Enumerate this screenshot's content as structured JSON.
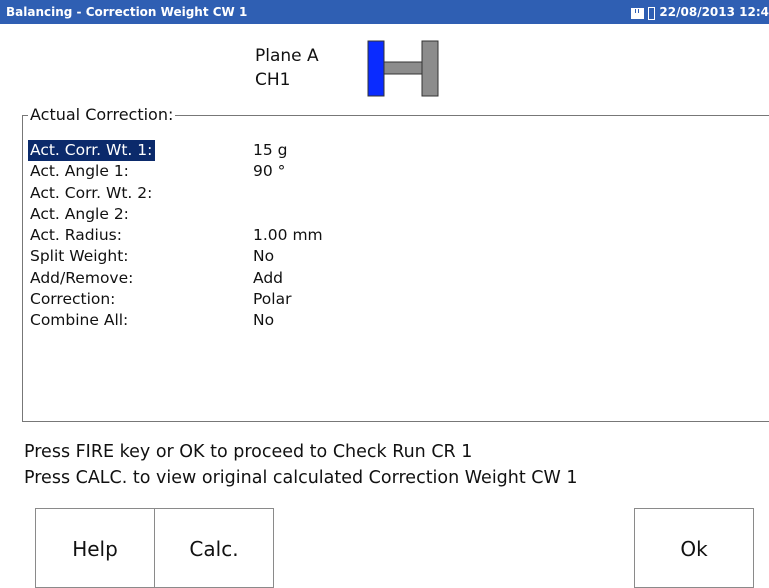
{
  "title_bar": {
    "title": "Balancing - Correction Weight CW 1",
    "datetime": "22/08/2013 12:4",
    "icons": [
      "memory-card-icon",
      "battery-icon"
    ]
  },
  "plane": {
    "name": "Plane A",
    "channel": "CH1"
  },
  "group": {
    "legend": "Actual Correction:",
    "fields": [
      {
        "label": "Act. Corr. Wt. 1:",
        "value": "15 g",
        "selected": true
      },
      {
        "label": "Act. Angle 1:",
        "value": "90 °"
      },
      {
        "label": "Act. Corr. Wt. 2:",
        "value": ""
      },
      {
        "label": "Act. Angle 2:",
        "value": ""
      },
      {
        "label": "Act. Radius:",
        "value": "1.00 mm"
      },
      {
        "label": "Split Weight:",
        "value": "No"
      },
      {
        "label": "Add/Remove:",
        "value": "Add"
      },
      {
        "label": "Correction:",
        "value": "Polar"
      },
      {
        "label": "Combine All:",
        "value": "No"
      }
    ]
  },
  "messages": [
    "Press FIRE key or OK to proceed to Check Run CR 1",
    "Press CALC. to view original calculated Correction Weight CW 1"
  ],
  "softkeys": {
    "help": "Help",
    "calc": "Calc.",
    "ok": "Ok"
  },
  "colors": {
    "title_bar": "#2f5fb3",
    "selection": "#0b2a6b",
    "plane_highlight": "#0a2bff",
    "rotor_gray": "#8c8c8c"
  }
}
